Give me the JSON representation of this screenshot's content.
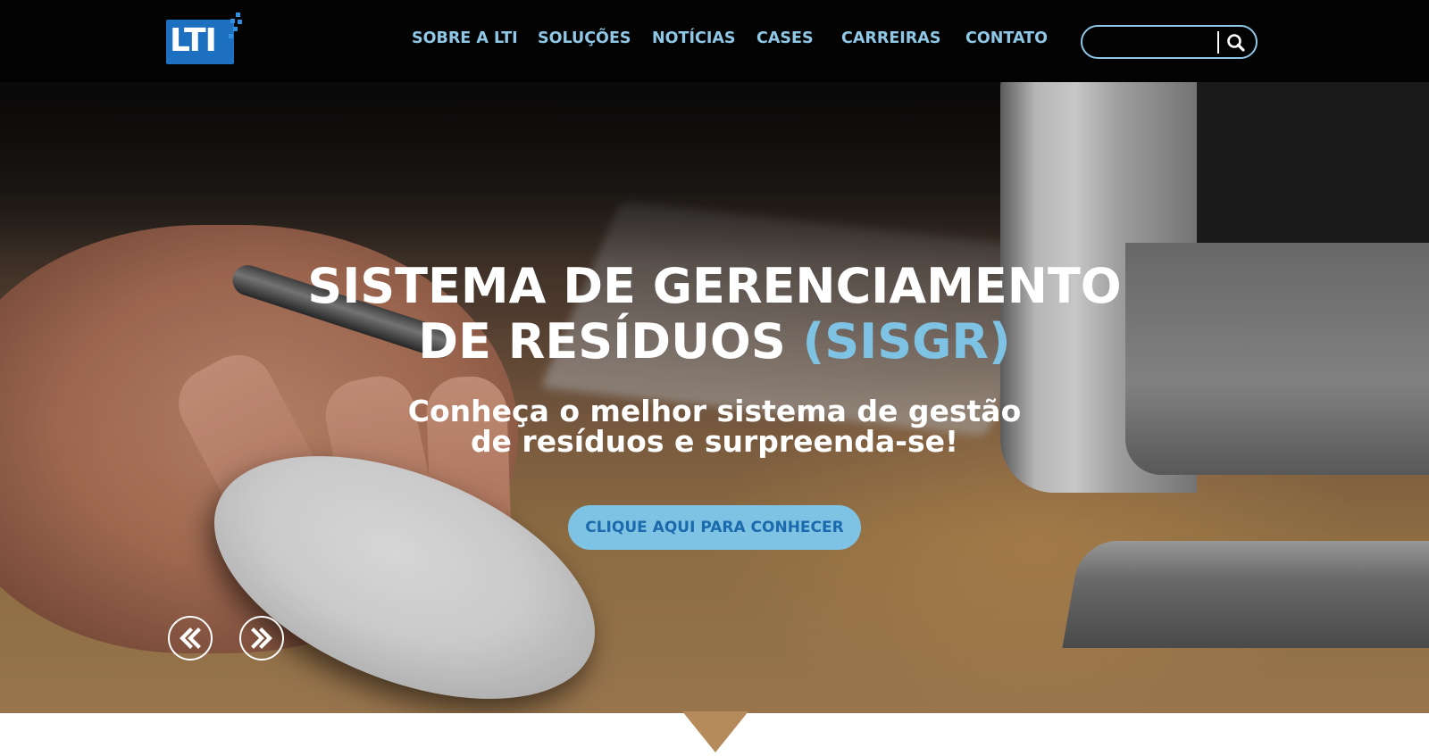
{
  "header": {
    "logo_text": "LTI",
    "nav": [
      {
        "label": "SOBRE A LTI"
      },
      {
        "label": "SOLUÇÕES"
      },
      {
        "label": "NOTÍCIAS"
      },
      {
        "label": "CASES"
      },
      {
        "label": "CARREIRAS"
      },
      {
        "label": "CONTATO"
      }
    ],
    "search": {
      "value": "",
      "placeholder": "",
      "icon": "search-icon"
    }
  },
  "hero": {
    "title_line1": "SISTEMA DE GERENCIAMENTO",
    "title_line2_main": "DE RESÍDUOS",
    "title_line2_accent": "(SISGR)",
    "subtitle_line1": "Conheça o melhor sistema de gestão",
    "subtitle_line2": "de resíduos e surpreenda-se!",
    "cta_label": "CLIQUE AQUI PARA CONHECER",
    "prev_icon": "double-chevron-left-icon",
    "next_icon": "double-chevron-right-icon"
  },
  "colors": {
    "header_bg": "#030303",
    "nav_text": "#8fc7e6",
    "accent": "#7fc3e4",
    "cta_text": "#1a6aad",
    "logo_blue": "#1d6fbf"
  }
}
